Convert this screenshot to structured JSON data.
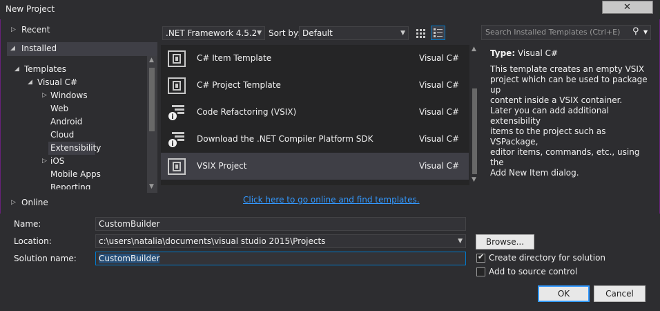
{
  "window": {
    "title": "New Project"
  },
  "nav": {
    "recent": "Recent",
    "installed": "Installed",
    "templates": "Templates",
    "visual_csharp": "Visual C#",
    "children": [
      "Windows",
      "Web",
      "Android",
      "Cloud",
      "Extensibility",
      "iOS",
      "Mobile Apps",
      "Reporting"
    ],
    "online": "Online"
  },
  "toolbar": {
    "framework": ".NET Framework 4.5.2",
    "sort_label": "Sort by:",
    "sort_value": "Default",
    "search_placeholder": "Search Installed Templates (Ctrl+E)"
  },
  "templates": [
    {
      "name": "C# Item Template",
      "lang": "Visual C#"
    },
    {
      "name": "C# Project Template",
      "lang": "Visual C#"
    },
    {
      "name": "Code Refactoring (VSIX)",
      "lang": "Visual C#"
    },
    {
      "name": "Download the .NET Compiler Platform SDK",
      "lang": "Visual C#"
    },
    {
      "name": "VSIX Project",
      "lang": "Visual C#"
    }
  ],
  "online_link": "Click here to go online and find templates.",
  "details": {
    "type_label": "Type:",
    "type_value": "Visual C#",
    "line1": "This template creates an empty VSIX",
    "line2": "project which can be used to package up",
    "line3": "content inside a VSIX container.",
    "line4": "Later you can add additional extensibility",
    "line5": "items to the project such as VSPackage,",
    "line6": "editor items, commands, etc., using the",
    "line7": "Add New Item dialog."
  },
  "form": {
    "name_label": "Name:",
    "name_value": "CustomBuilder",
    "location_label": "Location:",
    "location_value": "c:\\users\\natalia\\documents\\visual studio 2015\\Projects",
    "solution_label": "Solution name:",
    "solution_value": "CustomBuilder",
    "browse": "Browse...",
    "create_dir": "Create directory for solution",
    "add_source": "Add to source control",
    "ok": "OK",
    "cancel": "Cancel"
  },
  "colors": {
    "accent": "#007acc",
    "link": "#3399ff",
    "border": "#68217a"
  }
}
